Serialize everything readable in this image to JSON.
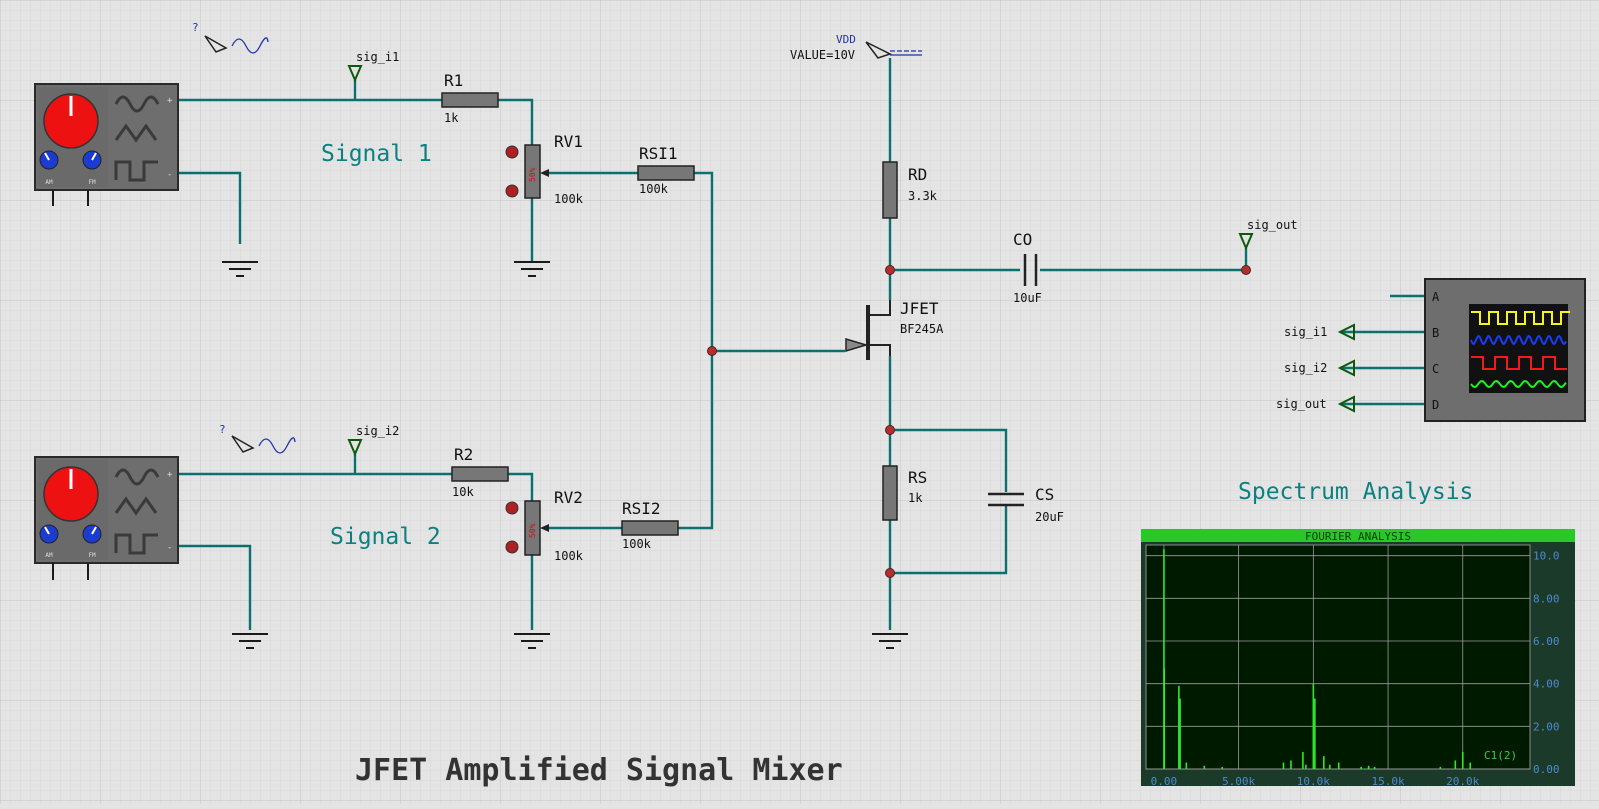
{
  "title": "JFET Amplified Signal Mixer",
  "section_labels": {
    "signal1": "Signal 1",
    "signal2": "Signal 2",
    "spectrum": "Spectrum Analysis"
  },
  "generators": [
    {
      "am": "AM",
      "fm": "FM",
      "plus": "+",
      "minus": "-",
      "probe": "?"
    },
    {
      "am": "AM",
      "fm": "FM",
      "plus": "+",
      "minus": "-",
      "probe": "?"
    }
  ],
  "terminals": {
    "sig_i1": "sig_i1",
    "sig_i2": "sig_i2",
    "sig_out": "sig_out",
    "vdd": "VDD",
    "vdd_value": "VALUE=10V"
  },
  "components": {
    "r1": {
      "name": "R1",
      "value": "1k"
    },
    "r2": {
      "name": "R2",
      "value": "10k"
    },
    "rv1": {
      "name": "RV1",
      "value": "100k",
      "pct": "50%"
    },
    "rv2": {
      "name": "RV2",
      "value": "100k",
      "pct": "50%"
    },
    "rsi1": {
      "name": "RSI1",
      "value": "100k"
    },
    "rsi2": {
      "name": "RSI2",
      "value": "100k"
    },
    "rd": {
      "name": "RD",
      "value": "3.3k"
    },
    "rs": {
      "name": "RS",
      "value": "1k"
    },
    "co": {
      "name": "CO",
      "value": "10uF"
    },
    "cs": {
      "name": "CS",
      "value": "20uF"
    },
    "jfet": {
      "name": "JFET",
      "value": "BF245A"
    }
  },
  "oscilloscope": {
    "channels": [
      "A",
      "B",
      "C",
      "D"
    ],
    "inputs": [
      "sig_i1",
      "sig_i2",
      "sig_out"
    ],
    "trace_colors": [
      "#f5f51a",
      "#1a3cf5",
      "#f51a1a",
      "#1af51a"
    ]
  },
  "fourier": {
    "header": "FOURIER ANALYSIS",
    "trace_label": "C1(2)",
    "x_ticks": [
      "0.00",
      "5.00k",
      "10.0k",
      "15.0k",
      "20.0k"
    ],
    "y_ticks": [
      "0.00",
      "2.00",
      "4.00",
      "6.00",
      "8.00",
      "10.0"
    ]
  },
  "chart_data": {
    "type": "bar",
    "title": "FOURIER ANALYSIS",
    "xlabel": "",
    "ylabel": "",
    "xlim": [
      -1200,
      24500
    ],
    "ylim": [
      0,
      10.5
    ],
    "grid": true,
    "series": [
      {
        "name": "C1(2)",
        "color": "#2ee82e",
        "x": [
          0,
          20,
          1000,
          1080,
          1500,
          2700,
          3900,
          8000,
          8500,
          9300,
          9500,
          10000,
          10100,
          10700,
          11100,
          11700,
          13200,
          13700,
          14100,
          18500,
          19500,
          20000,
          20500
        ],
        "y": [
          10.3,
          4.7,
          3.9,
          3.3,
          0.3,
          0.15,
          0.1,
          0.3,
          0.4,
          0.8,
          0.2,
          4.0,
          3.3,
          0.6,
          0.2,
          0.3,
          0.1,
          0.15,
          0.1,
          0.1,
          0.4,
          0.8,
          0.3
        ]
      }
    ]
  }
}
